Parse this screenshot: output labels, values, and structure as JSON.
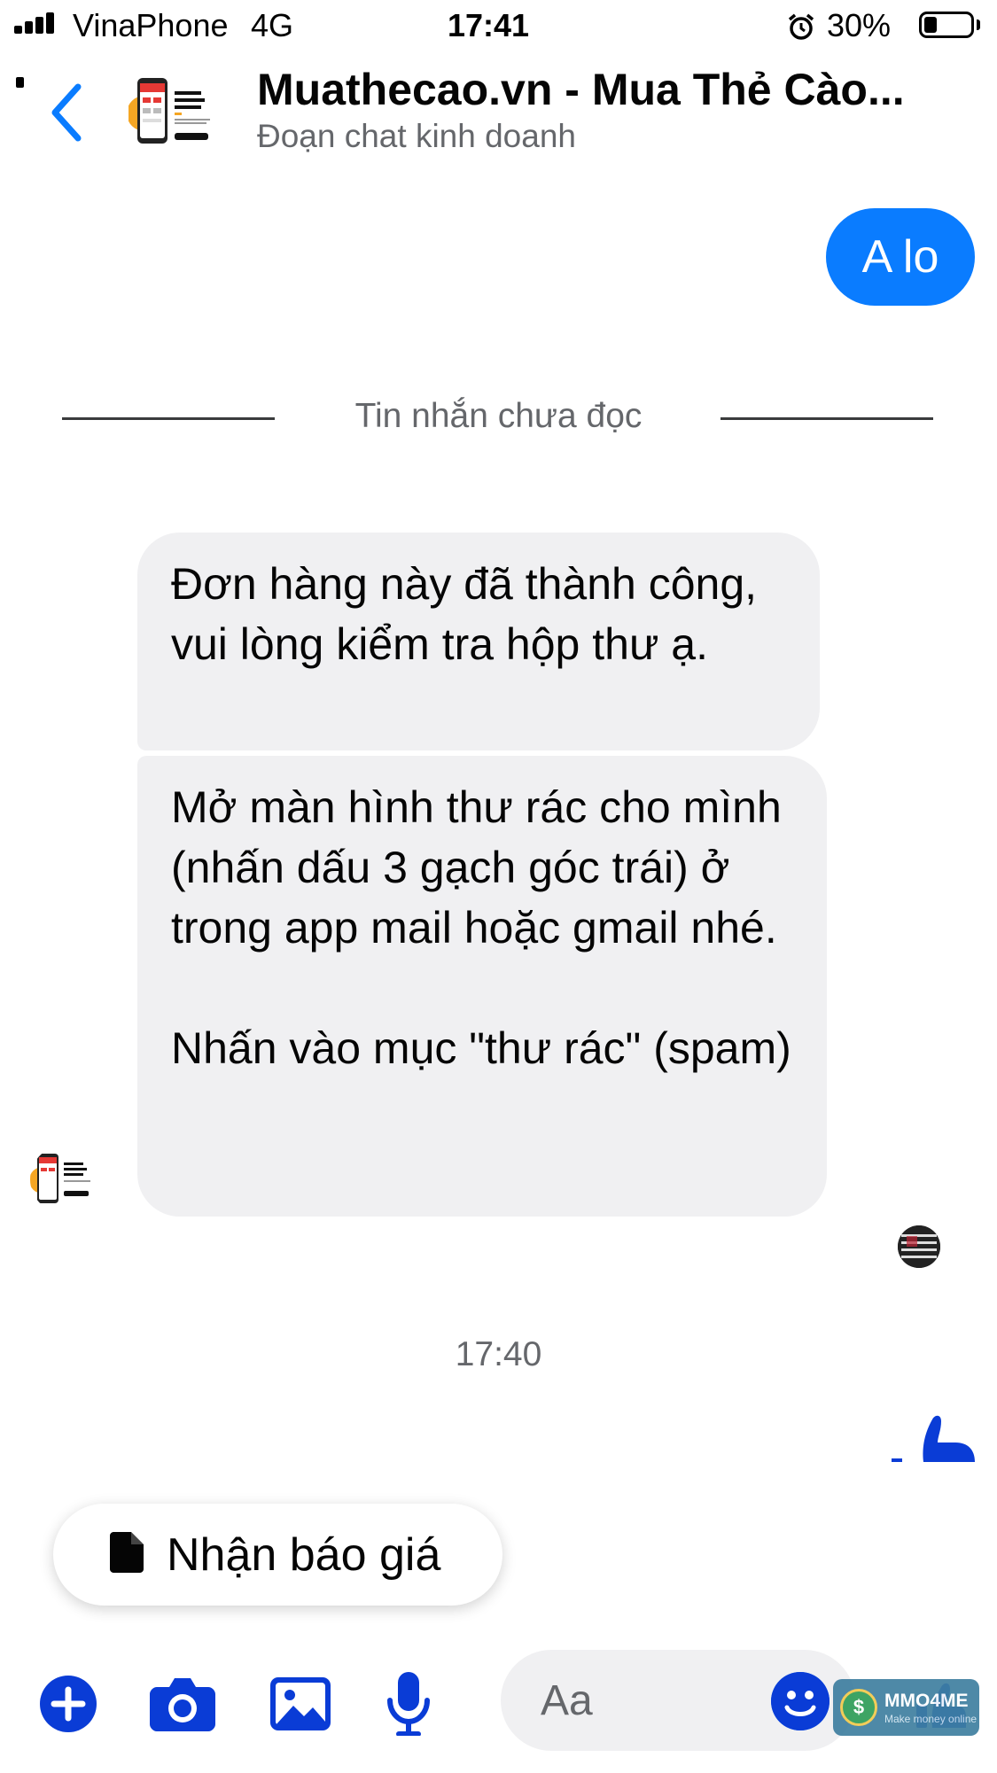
{
  "status_bar": {
    "carrier": "VinaPhone",
    "network": "4G",
    "time": "17:41",
    "battery_percent": "30%",
    "battery_level": 0.3,
    "signal_bars": 4
  },
  "header": {
    "title": "Muathecao.vn - Mua Thẻ Cào...",
    "subtitle": "Đoạn chat kinh doanh",
    "back_icon": "chevron-left-icon",
    "avatar_lines": [
      "MUA THẺ",
      "MỌI LÚC",
      "MỌI NƠI"
    ]
  },
  "messages": {
    "outgoing_1": "A lo",
    "unread_divider": "Tin nhắn chưa đọc",
    "incoming_1": "Đơn hàng này đã thành công, vui lòng kiểm tra hộp thư ạ.",
    "incoming_2": "Mở màn hình thư rác cho mình (nhấn dấu 3 gạch góc trái) ở trong app mail hoặc gmail nhé.\n\nNhấn vào mục \"thư rác\" (spam)",
    "timestamp": "17:40"
  },
  "quick_reply": {
    "label": "Nhận báo giá",
    "icon": "document-icon"
  },
  "composer": {
    "placeholder": "Aa",
    "buttons": [
      "plus-icon",
      "camera-icon",
      "image-icon",
      "microphone-icon",
      "emoji-icon",
      "like-icon"
    ]
  },
  "watermark": {
    "title": "MMO4ME",
    "subtitle": "Make money online"
  },
  "colors": {
    "accent": "#0a7cff",
    "bubble_in": "#f0f0f2",
    "secondary_text": "#65676b"
  }
}
